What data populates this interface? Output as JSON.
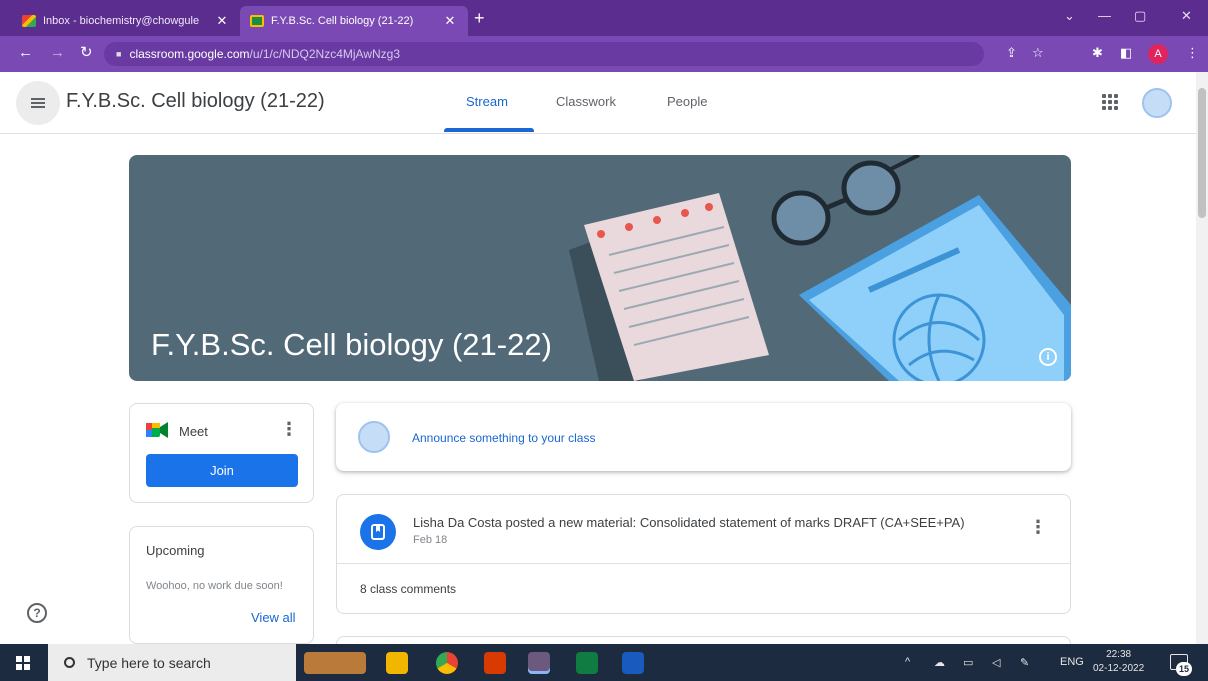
{
  "browser": {
    "tabs": [
      {
        "title": "Inbox - biochemistry@chowgule",
        "close": "✕",
        "icon": "gmail-icon"
      },
      {
        "title": "F.Y.B.Sc. Cell biology (21-22)",
        "close": "✕",
        "icon": "classroom-icon"
      }
    ],
    "new_tab": "+",
    "url_host": "classroom.google.com",
    "url_path": "/u/1/c/NDQ2Nzc4MjAwNzg3",
    "profile_initial": "A",
    "window_controls": [
      "⌄",
      "—",
      "▢",
      "✕"
    ]
  },
  "classroom": {
    "class_name": "F.Y.B.Sc. Cell biology (21-22)",
    "tabs": [
      "Stream",
      "Classwork",
      "People"
    ],
    "active_tab": "Stream",
    "banner_title": "F.Y.B.Sc. Cell biology (21-22)",
    "meet": {
      "label": "Meet",
      "join": "Join"
    },
    "upcoming": {
      "title": "Upcoming",
      "empty": "Woohoo, no work due soon!",
      "view_all": "View all"
    },
    "announce_placeholder": "Announce something to your class",
    "post": {
      "title": "Lisha Da Costa posted a new material: Consolidated statement of marks DRAFT (CA+SEE+PA)",
      "date": "Feb 18",
      "comments": "8 class comments"
    },
    "help": "?"
  },
  "taskbar": {
    "search_placeholder": "Type here to search",
    "language": "ENG",
    "time": "22:38",
    "date": "02-12-2022",
    "notification_count": "15"
  },
  "colors": {
    "browser_frame": "#5b2d8e",
    "active_tab": "#7a49b4",
    "accent_blue": "#1967d2",
    "join_button": "#1a73e8",
    "banner": "#526a78",
    "taskbar": "#1c2b3f"
  }
}
